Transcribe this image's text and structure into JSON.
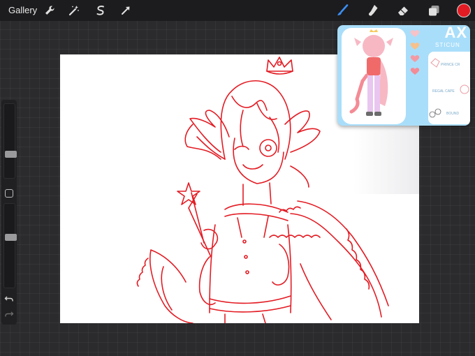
{
  "toolbar": {
    "gallery_label": "Gallery",
    "left_tools": [
      {
        "name": "actions",
        "icon": "wrench-icon"
      },
      {
        "name": "adjustments",
        "icon": "magic-wand-icon"
      },
      {
        "name": "selection",
        "icon": "selection-s-icon"
      },
      {
        "name": "transform",
        "icon": "arrow-cursor-icon"
      }
    ],
    "right_tools": [
      {
        "name": "brush",
        "icon": "brush-icon",
        "active": true,
        "color": "#3a8ff5"
      },
      {
        "name": "smudge",
        "icon": "smudge-finger-icon",
        "active": false
      },
      {
        "name": "eraser",
        "icon": "eraser-icon",
        "active": false
      },
      {
        "name": "layers",
        "icon": "layers-icon",
        "active": false
      }
    ],
    "current_color": "#e31b23"
  },
  "sidebar": {
    "brush_size_level": 0.32,
    "opacity_level": 0.62,
    "modify_button_icon": "square-icon",
    "undo_icon": "undo-icon",
    "redo_icon": "redo-icon"
  },
  "canvas": {
    "background": "#ffffff",
    "sketch_color": "#e31b23",
    "content": "red line sketch of a character with crown, star wand, cape and tail"
  },
  "reference_window": {
    "title": "AX",
    "subtitle": "STICUN",
    "background": "#a9defa",
    "panel_labels": [
      "PRINCE CR",
      "REGAL CAPE",
      "BOUND"
    ],
    "swatch_colors": [
      "#f7c2c8",
      "#f8c08a",
      "#f49aa3",
      "#f48b95"
    ]
  }
}
